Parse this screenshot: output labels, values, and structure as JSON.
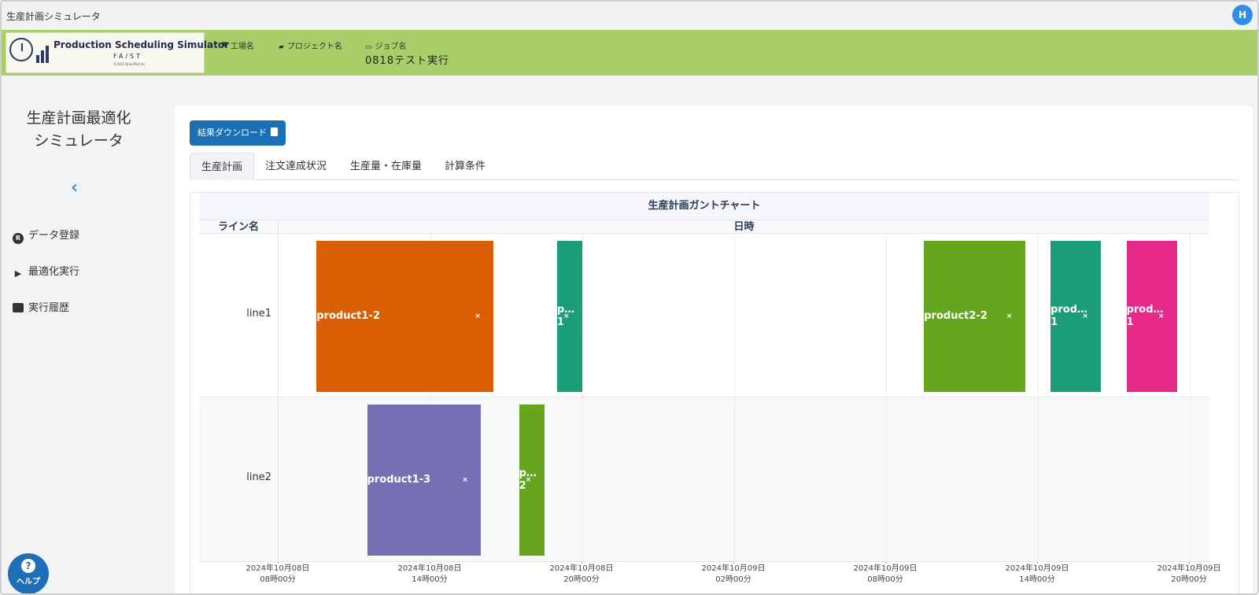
{
  "app": {
    "title": "生産計画シミュレータ",
    "user_initial": "H"
  },
  "header": {
    "logo": {
      "title": "Production Scheduling Simulator",
      "subtitle": "FA/ST",
      "copyright": "©2022 BrainPad Inc."
    },
    "factory_label": "工場名",
    "project_label": "プロジェクト名",
    "job_label": "ジョブ名",
    "job_value": "0818テスト実行"
  },
  "sidebar": {
    "title_line1": "生産計画最適化",
    "title_line2": "シミュレータ",
    "items": [
      {
        "label": "データ登録",
        "icon": "r-circle-icon"
      },
      {
        "label": "最適化実行",
        "icon": "play-step-icon"
      },
      {
        "label": "実行履歴",
        "icon": "archive-icon"
      }
    ],
    "help_label": "ヘルプ",
    "help_icon": "?"
  },
  "main": {
    "download_button": "結果ダウンロード",
    "tabs": [
      {
        "label": "生産計画",
        "active": true
      },
      {
        "label": "注文達成状況",
        "active": false
      },
      {
        "label": "生産量・在庫量",
        "active": false
      },
      {
        "label": "計算条件",
        "active": false
      }
    ]
  },
  "gantt": {
    "title": "生産計画ガントチャート",
    "col_line": "ライン名",
    "col_date": "日時",
    "lines": [
      "line1",
      "line2"
    ],
    "ticks": [
      {
        "date": "2024年10月08日",
        "time": "08時00分"
      },
      {
        "date": "2024年10月08日",
        "time": "14時00分"
      },
      {
        "date": "2024年10月08日",
        "time": "20時00分"
      },
      {
        "date": "2024年10月09日",
        "time": "02時00分"
      },
      {
        "date": "2024年10月09日",
        "time": "08時00分"
      },
      {
        "date": "2024年10月09日",
        "time": "14時00分"
      },
      {
        "date": "2024年10月09日",
        "time": "20時00分"
      }
    ],
    "tasks": [
      {
        "line": 0,
        "label": "product1-2",
        "start": 1.5,
        "end": 8.5,
        "color": "#d95f02",
        "close": "×"
      },
      {
        "line": 0,
        "label": "p…\n1",
        "start": 11.0,
        "end": 12.0,
        "color": "#1b9e77",
        "close": "×"
      },
      {
        "line": 0,
        "label": "product2-2",
        "start": 25.5,
        "end": 29.5,
        "color": "#66a61e",
        "close": "×"
      },
      {
        "line": 0,
        "label": "prod…\n1",
        "start": 30.5,
        "end": 32.5,
        "color": "#1b9e77",
        "close": "×"
      },
      {
        "line": 0,
        "label": "prod…\n1",
        "start": 33.5,
        "end": 35.5,
        "color": "#e7298a",
        "close": "×"
      },
      {
        "line": 1,
        "label": "product1-3",
        "start": 3.5,
        "end": 8.0,
        "color": "#7570b3",
        "close": "×"
      },
      {
        "line": 1,
        "label": "p…\n2",
        "start": 9.5,
        "end": 10.5,
        "color": "#66a61e",
        "close": "×"
      }
    ]
  }
}
